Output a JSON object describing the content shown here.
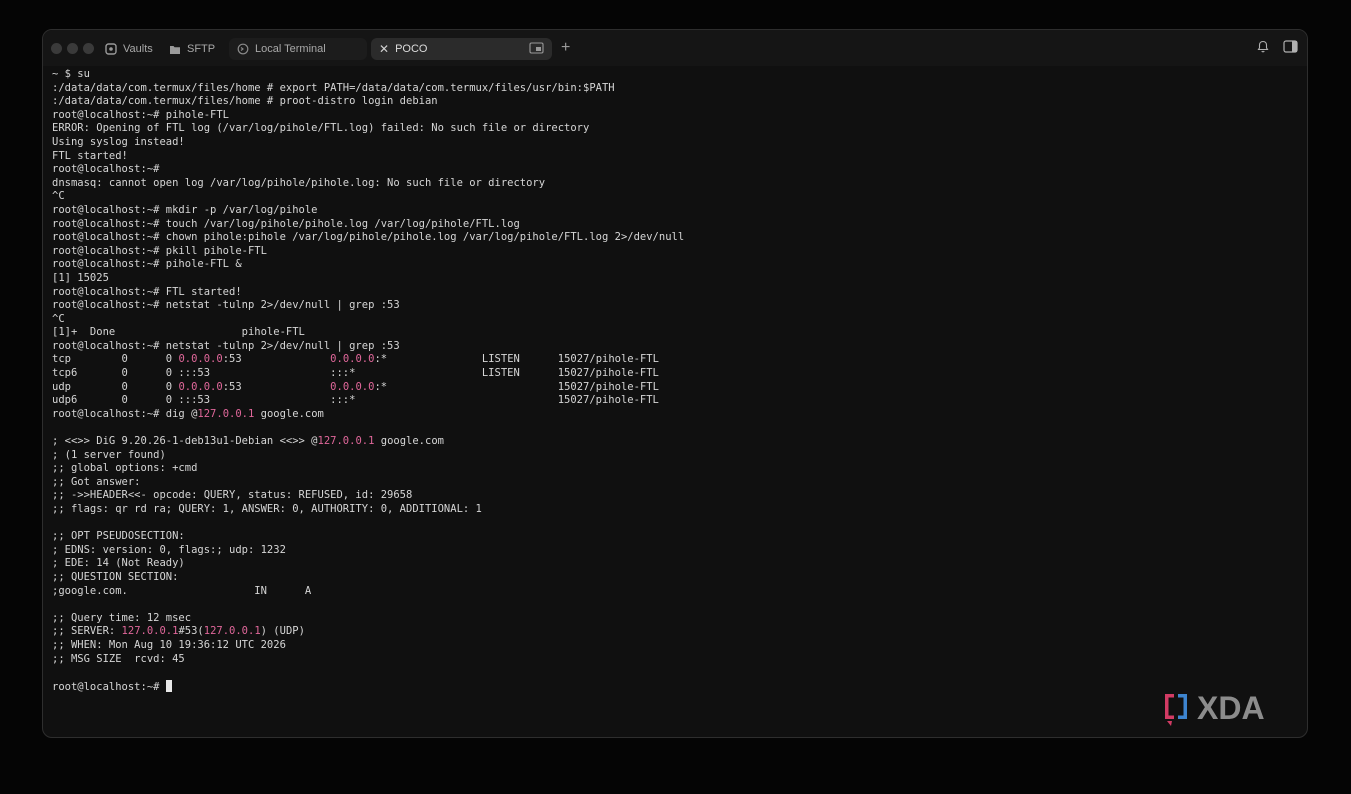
{
  "tabs": [
    {
      "label": "Vaults",
      "icon": "vault-icon"
    },
    {
      "label": "SFTP",
      "icon": "folder-icon"
    },
    {
      "label": "Local Terminal",
      "icon": "terminal-icon"
    },
    {
      "label": "POCO",
      "icon": "close-icon",
      "active": true
    }
  ],
  "logo_text": "XDA",
  "terminal_lines": [
    [
      {
        "t": "~ $ su"
      }
    ],
    [
      {
        "t": ":/data/data/com.termux/files/home # export PATH=/data/data/com.termux/files/usr/bin:$PATH"
      }
    ],
    [
      {
        "t": ":/data/data/com.termux/files/home # proot-distro login debian"
      }
    ],
    [
      {
        "t": "root@localhost:~# pihole-FTL"
      }
    ],
    [
      {
        "t": "ERROR: Opening of FTL log (/var/log/pihole/FTL.log) failed: No such file or directory"
      }
    ],
    [
      {
        "t": "Using syslog instead!"
      }
    ],
    [
      {
        "t": "FTL started!"
      }
    ],
    [
      {
        "t": "root@localhost:~#"
      }
    ],
    [
      {
        "t": "dnsmasq: cannot open log /var/log/pihole/pihole.log: No such file or directory"
      }
    ],
    [
      {
        "t": "^C"
      }
    ],
    [
      {
        "t": "root@localhost:~# mkdir -p /var/log/pihole"
      }
    ],
    [
      {
        "t": "root@localhost:~# touch /var/log/pihole/pihole.log /var/log/pihole/FTL.log"
      }
    ],
    [
      {
        "t": "root@localhost:~# chown pihole:pihole /var/log/pihole/pihole.log /var/log/pihole/FTL.log 2>/dev/null"
      }
    ],
    [
      {
        "t": "root@localhost:~# pkill pihole-FTL"
      }
    ],
    [
      {
        "t": "root@localhost:~# pihole-FTL &"
      }
    ],
    [
      {
        "t": "[1] 15025"
      }
    ],
    [
      {
        "t": "root@localhost:~# FTL started!"
      }
    ],
    [
      {
        "t": "root@localhost:~# netstat -tulnp 2>/dev/null | grep :53"
      }
    ],
    [
      {
        "t": "^C"
      }
    ],
    [
      {
        "t": "[1]+  Done                    pihole-FTL"
      }
    ],
    [
      {
        "t": "root@localhost:~# netstat -tulnp 2>/dev/null | grep :53"
      }
    ],
    [
      {
        "t": "tcp        0      0 "
      },
      {
        "t": "0.0.0.0",
        "c": "ip"
      },
      {
        "t": ":53              "
      },
      {
        "t": "0.0.0.0",
        "c": "ip"
      },
      {
        "t": ":*               LISTEN      15027/pihole-FTL"
      }
    ],
    [
      {
        "t": "tcp6       0      0 :::53                   :::*                    LISTEN      15027/pihole-FTL"
      }
    ],
    [
      {
        "t": "udp        0      0 "
      },
      {
        "t": "0.0.0.0",
        "c": "ip"
      },
      {
        "t": ":53              "
      },
      {
        "t": "0.0.0.0",
        "c": "ip"
      },
      {
        "t": ":*                           15027/pihole-FTL"
      }
    ],
    [
      {
        "t": "udp6       0      0 :::53                   :::*                                15027/pihole-FTL"
      }
    ],
    [
      {
        "t": "root@localhost:~# dig @"
      },
      {
        "t": "127.0.0.1",
        "c": "ip"
      },
      {
        "t": " google.com"
      }
    ],
    [
      {
        "t": ""
      }
    ],
    [
      {
        "t": "; <<>> DiG 9.20.26-1-deb13u1-Debian <<>> @"
      },
      {
        "t": "127.0.0.1",
        "c": "ip"
      },
      {
        "t": " google.com"
      }
    ],
    [
      {
        "t": "; (1 server found)"
      }
    ],
    [
      {
        "t": ";; global options: +cmd"
      }
    ],
    [
      {
        "t": ";; Got answer:"
      }
    ],
    [
      {
        "t": ";; ->>HEADER<<- opcode: QUERY, status: REFUSED, id: 29658"
      }
    ],
    [
      {
        "t": ";; flags: qr rd ra; QUERY: 1, ANSWER: 0, AUTHORITY: 0, ADDITIONAL: 1"
      }
    ],
    [
      {
        "t": ""
      }
    ],
    [
      {
        "t": ";; OPT PSEUDOSECTION:"
      }
    ],
    [
      {
        "t": "; EDNS: version: 0, flags:; udp: 1232"
      }
    ],
    [
      {
        "t": "; EDE: 14 (Not Ready)"
      }
    ],
    [
      {
        "t": ";; QUESTION SECTION:"
      }
    ],
    [
      {
        "t": ";google.com.                    IN      A"
      }
    ],
    [
      {
        "t": ""
      }
    ],
    [
      {
        "t": ";; Query time: 12 msec"
      }
    ],
    [
      {
        "t": ";; SERVER: "
      },
      {
        "t": "127.0.0.1",
        "c": "ip"
      },
      {
        "t": "#53("
      },
      {
        "t": "127.0.0.1",
        "c": "ip"
      },
      {
        "t": ") (UDP)"
      }
    ],
    [
      {
        "t": ";; WHEN: Mon Aug 10 19:36:12 UTC 2026"
      }
    ],
    [
      {
        "t": ";; MSG SIZE  rcvd: 45"
      }
    ],
    [
      {
        "t": ""
      }
    ],
    [
      {
        "t": "root@localhost:~# "
      }
    ]
  ]
}
